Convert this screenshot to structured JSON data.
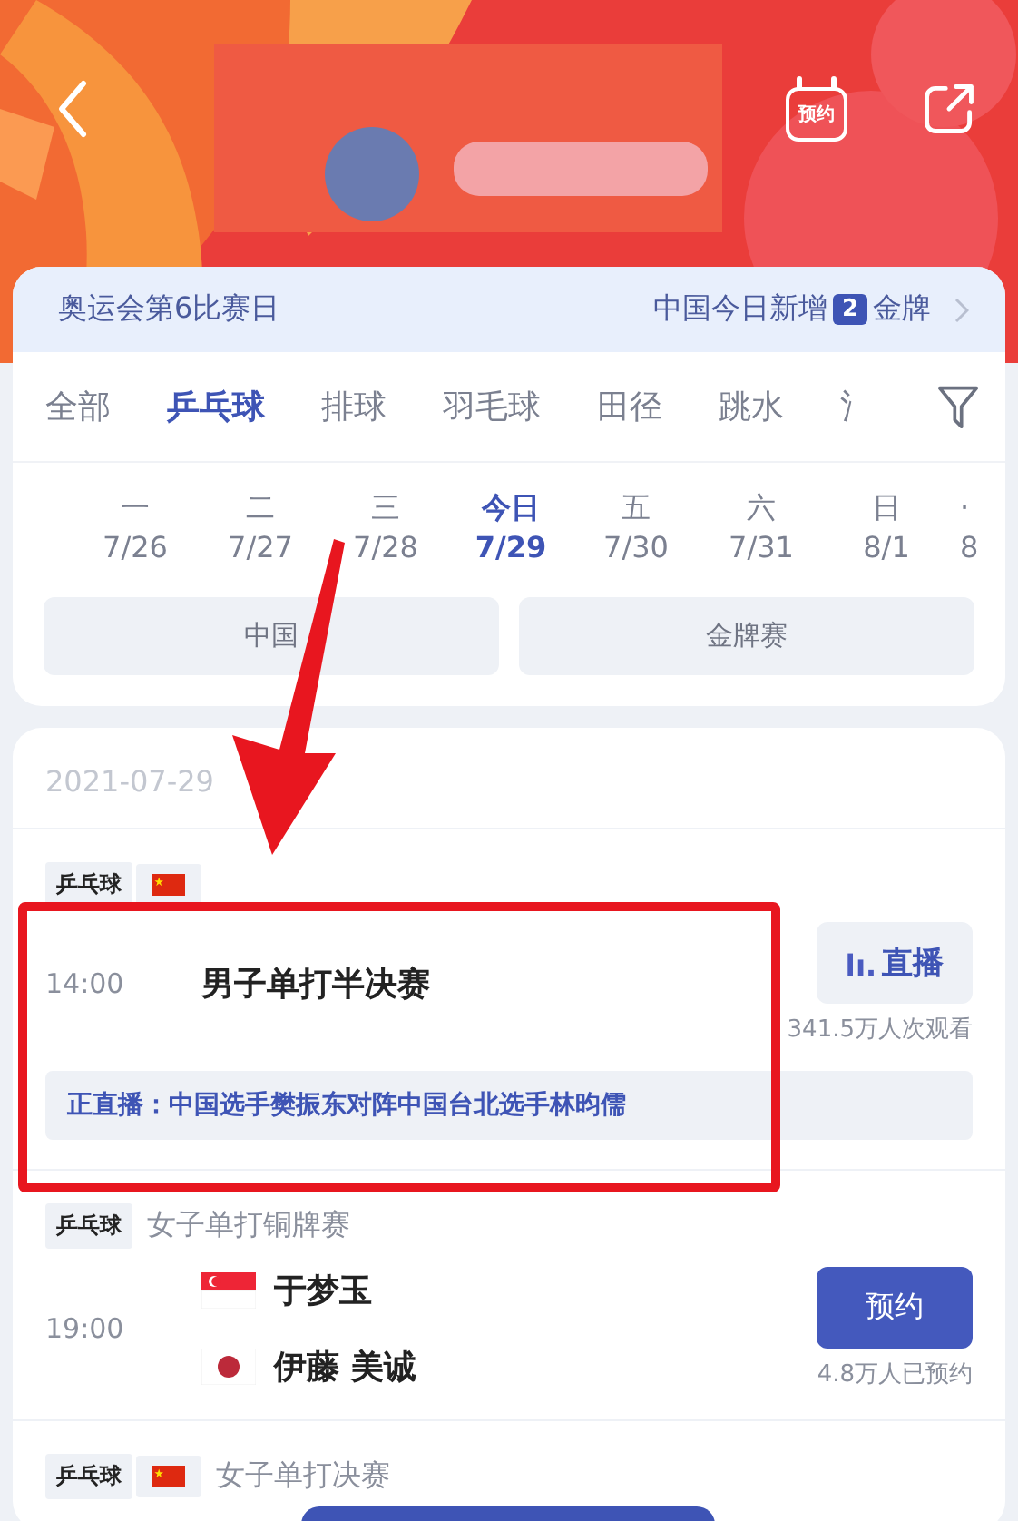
{
  "header": {
    "reserve_icon_label": "预约"
  },
  "summary": {
    "left": "奥运会第6比赛日",
    "right_prefix": "中国今日新增",
    "count": "2",
    "right_suffix": "金牌"
  },
  "sports_tabs": [
    {
      "label": "全部",
      "selected": false
    },
    {
      "label": "乒乓球",
      "selected": true
    },
    {
      "label": "排球",
      "selected": false
    },
    {
      "label": "羽毛球",
      "selected": false
    },
    {
      "label": "田径",
      "selected": false
    },
    {
      "label": "跳水",
      "selected": false
    },
    {
      "label": "氵",
      "selected": false
    }
  ],
  "dates": [
    {
      "weekday": "一",
      "date": "7/26",
      "selected": false
    },
    {
      "weekday": "二",
      "date": "7/27",
      "selected": false
    },
    {
      "weekday": "三",
      "date": "7/28",
      "selected": false
    },
    {
      "weekday": "今日",
      "date": "7/29",
      "selected": true
    },
    {
      "weekday": "五",
      "date": "7/30",
      "selected": false
    },
    {
      "weekday": "六",
      "date": "7/31",
      "selected": false
    },
    {
      "weekday": "日",
      "date": "8/1",
      "selected": false
    },
    {
      "weekday": "·",
      "date": "8",
      "selected": false
    }
  ],
  "filters": [
    "中国",
    "金牌赛"
  ],
  "schedule": {
    "date": "2021-07-29",
    "matches": [
      {
        "kind": "live",
        "sport": "乒乓球",
        "china_flag": true,
        "time": "14:00",
        "title": "男子单打半决赛",
        "action": "直播",
        "count": "341.5万人次观看",
        "live_text": "正直播：中国选手樊振东对阵中国台北选手林昀儒"
      },
      {
        "kind": "versus",
        "sport": "乒乓球",
        "china_flag": false,
        "title": "女子单打铜牌赛",
        "time": "19:00",
        "players": [
          {
            "name": "于梦玉",
            "kind": "singapore"
          },
          {
            "name": "伊藤 美诚",
            "kind": "japan"
          }
        ],
        "action": "预约",
        "count": "4.8万人已预约"
      },
      {
        "kind": "header_only",
        "sport": "乒乓球",
        "china_flag": true,
        "title": "女子单打决赛"
      }
    ]
  }
}
